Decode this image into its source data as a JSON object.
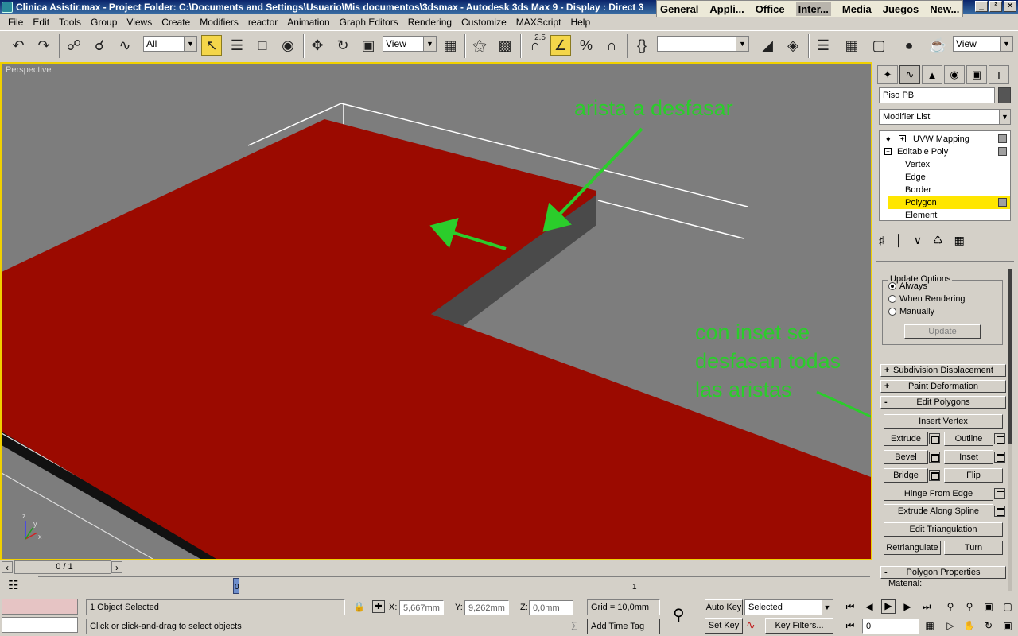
{
  "window": {
    "title": "Clinica Asistir.max    - Project Folder: C:\\Documents and Settings\\Usuario\\Mis documentos\\3dsmax    - Autodesk 3ds Max 9    - Display : Direct 3",
    "taskbar_tabs": [
      "General",
      "Appli...",
      "Office",
      "Inter...",
      "Media",
      "Juegos",
      "New..."
    ],
    "active_taskbar_tab": "Inter...",
    "controls": [
      "_",
      "²",
      "×"
    ]
  },
  "menu": [
    "File",
    "Edit",
    "Tools",
    "Group",
    "Views",
    "Create",
    "Modifiers",
    "reactor",
    "Animation",
    "Graph Editors",
    "Rendering",
    "Customize",
    "MAXScript",
    "Help"
  ],
  "toolbar": {
    "selection_filter": "All",
    "ref_coord": "View",
    "named_selection": "",
    "view_dropdown": "View",
    "snap_label": "2.5"
  },
  "viewport": {
    "label": "Perspective",
    "annotation_top": "arista a desfasar",
    "annotation_bottom": [
      "con inset se",
      "desfasan todas",
      "las aristas"
    ],
    "axis_labels": {
      "x": "x",
      "y": "y",
      "z": "z"
    },
    "colors": {
      "floor": "#9b0a00",
      "background": "#7d7d7d",
      "arrow": "#2bcd2b",
      "active_border": "#f0d000"
    }
  },
  "command_panel": {
    "object_name": "Piso PB",
    "modifier_list": "Modifier List",
    "stack": [
      {
        "label": "UVW Mapping",
        "type": "modifier"
      },
      {
        "label": "Editable Poly",
        "type": "base"
      },
      {
        "label": "Vertex",
        "type": "sub"
      },
      {
        "label": "Edge",
        "type": "sub"
      },
      {
        "label": "Border",
        "type": "sub"
      },
      {
        "label": "Polygon",
        "type": "sub",
        "selected": true
      },
      {
        "label": "Element",
        "type": "sub"
      }
    ],
    "update_options": {
      "title": "Update Options",
      "options": [
        "Always",
        "When Rendering",
        "Manually"
      ],
      "selected": "Always",
      "update_button": "Update"
    },
    "rollouts": {
      "subdivision": "Subdivision Displacement",
      "paint": "Paint Deformation",
      "edit_polygons": "Edit Polygons",
      "polygon_props": "Polygon Properties",
      "material": "Material:"
    },
    "edit_polygons_buttons": {
      "insert_vertex": "Insert Vertex",
      "extrude": "Extrude",
      "outline": "Outline",
      "bevel": "Bevel",
      "inset": "Inset",
      "bridge": "Bridge",
      "flip": "Flip",
      "hinge": "Hinge From Edge",
      "extrude_spline": "Extrude Along Spline",
      "edit_tri": "Edit Triangulation",
      "retriangulate": "Retriangulate",
      "turn": "Turn"
    }
  },
  "timeline": {
    "frame_display": "0 / 1",
    "ruler_labels": [
      "0",
      "1"
    ]
  },
  "status": {
    "selection": "1 Object Selected",
    "prompt": "Click or click-and-drag to select objects",
    "x_label": "X:",
    "x": "5,667mm",
    "y_label": "Y:",
    "y": "9,262mm",
    "z_label": "Z:",
    "z": "0,0mm",
    "grid": "Grid = 10,0mm",
    "add_time_tag": "Add Time Tag",
    "auto_key": "Auto Key",
    "set_key": "Set Key",
    "key_filter": "Selected",
    "key_filters_btn": "Key Filters...",
    "current_frame": "0"
  }
}
